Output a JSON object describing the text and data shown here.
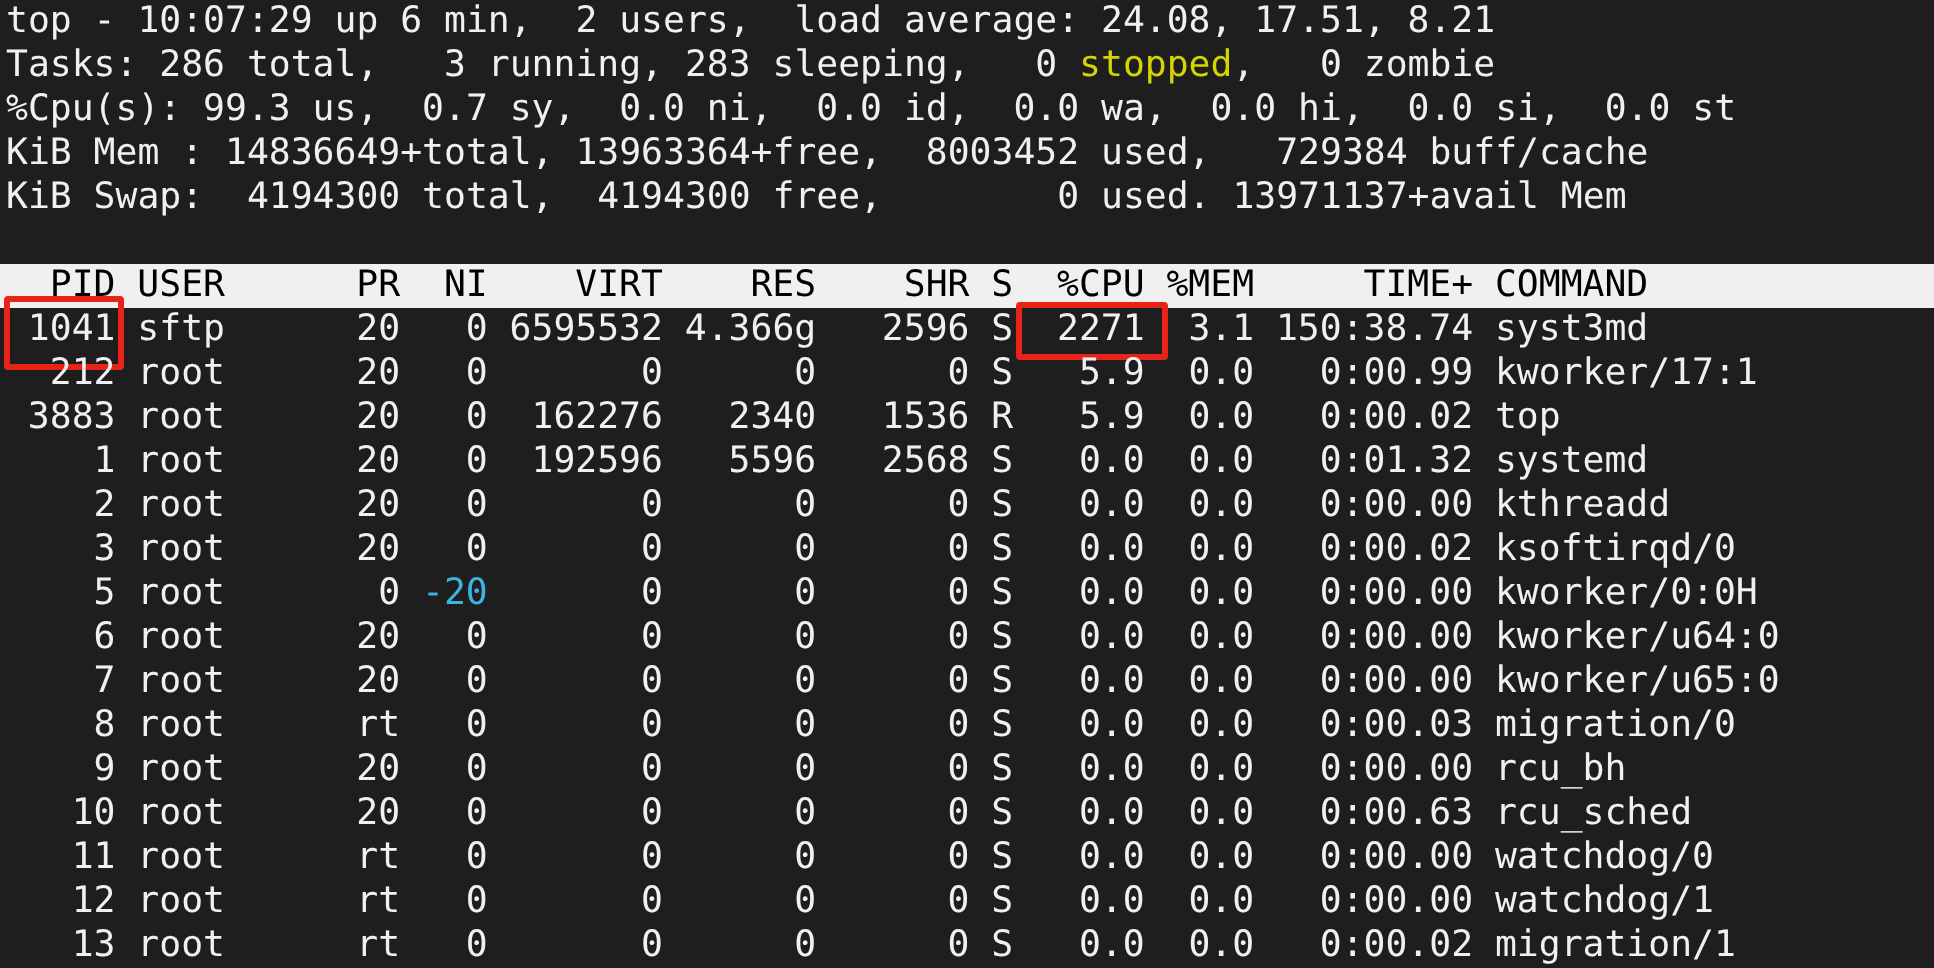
{
  "summary": [
    {
      "segments": [
        {
          "text": "top - 10:07:29 up 6 min,  2 users,  load average: 24.08, 17.51, 8.21"
        }
      ]
    },
    {
      "segments": [
        {
          "text": "Tasks: 286 total,   3 running, 283 sleeping,   0 "
        },
        {
          "text": "stopped",
          "color": "#d4d400"
        },
        {
          "text": ",   0 zombie"
        }
      ]
    },
    {
      "segments": [
        {
          "text": "%Cpu(s): 99.3 us,  0.7 sy,  0.0 ni,  0.0 id,  0.0 wa,  0.0 hi,  0.0 si,  0.0 st"
        }
      ]
    },
    {
      "segments": [
        {
          "text": "KiB Mem : 14836649+total, 13963364+free,  8003452 used,   729384 buff/cache"
        }
      ]
    },
    {
      "segments": [
        {
          "text": "KiB Swap:  4194300 total,  4194300 free,        0 used. 13971137+avail Mem"
        }
      ]
    }
  ],
  "table": {
    "columns": [
      "PID",
      "USER",
      "PR",
      "NI",
      "VIRT",
      "RES",
      "SHR",
      "S",
      "%CPU",
      "%MEM",
      "TIME+",
      "COMMAND"
    ],
    "rows": [
      {
        "cells": [
          "1041",
          "sftp",
          "20",
          "0",
          "6595532",
          "4.366g",
          "2596",
          "S",
          "2271",
          "3.1",
          "150:38.74",
          "syst3md"
        ],
        "pid_marked": true,
        "cpu_marked": true,
        "color": "#f0f0f0"
      },
      {
        "cells": [
          "212",
          "root",
          "20",
          "0",
          "0",
          "0",
          "0",
          "S",
          "5.9",
          "0.0",
          "0:00.99",
          "kworker/17:1"
        ],
        "pid_marked": false,
        "cpu_marked": false,
        "color": "#f0f0f0"
      },
      {
        "cells": [
          "3883",
          "root",
          "20",
          "0",
          "162276",
          "2340",
          "1536",
          "R",
          "5.9",
          "0.0",
          "0:00.02",
          "top"
        ],
        "pid_marked": false,
        "cpu_marked": false,
        "color": "#f0f0f0"
      },
      {
        "cells": [
          "1",
          "root",
          "20",
          "0",
          "192596",
          "5596",
          "2568",
          "S",
          "0.0",
          "0.0",
          "0:01.32",
          "systemd"
        ],
        "pid_marked": false,
        "cpu_marked": false,
        "color": "#f0f0f0"
      },
      {
        "cells": [
          "2",
          "root",
          "20",
          "0",
          "0",
          "0",
          "0",
          "S",
          "0.0",
          "0.0",
          "0:00.00",
          "kthreadd"
        ],
        "pid_marked": false,
        "cpu_marked": false,
        "color": "#f0f0f0"
      },
      {
        "cells": [
          "3",
          "root",
          "20",
          "0",
          "0",
          "0",
          "0",
          "S",
          "0.0",
          "0.0",
          "0:00.02",
          "ksoftirqd/0"
        ],
        "pid_marked": false,
        "cpu_marked": false,
        "color": "#f0f0f0"
      },
      {
        "cells": [
          "5",
          "root",
          "0",
          "-20",
          "0",
          "0",
          "0",
          "S",
          "0.0",
          "0.0",
          "0:00.00",
          "kworker/0:0H"
        ],
        "pid_marked": false,
        "cpu_marked": false,
        "color": "#3ab4e0"
      },
      {
        "cells": [
          "6",
          "root",
          "20",
          "0",
          "0",
          "0",
          "0",
          "S",
          "0.0",
          "0.0",
          "0:00.00",
          "kworker/u64:0"
        ],
        "pid_marked": false,
        "cpu_marked": false,
        "color": "#f0f0f0"
      },
      {
        "cells": [
          "7",
          "root",
          "20",
          "0",
          "0",
          "0",
          "0",
          "S",
          "0.0",
          "0.0",
          "0:00.00",
          "kworker/u65:0"
        ],
        "pid_marked": false,
        "cpu_marked": false,
        "color": "#f0f0f0"
      },
      {
        "cells": [
          "8",
          "root",
          "rt",
          "0",
          "0",
          "0",
          "0",
          "S",
          "0.0",
          "0.0",
          "0:00.03",
          "migration/0"
        ],
        "pid_marked": false,
        "cpu_marked": false,
        "color": "#f0f0f0"
      },
      {
        "cells": [
          "9",
          "root",
          "20",
          "0",
          "0",
          "0",
          "0",
          "S",
          "0.0",
          "0.0",
          "0:00.00",
          "rcu_bh"
        ],
        "pid_marked": false,
        "cpu_marked": false,
        "color": "#f0f0f0"
      },
      {
        "cells": [
          "10",
          "root",
          "20",
          "0",
          "0",
          "0",
          "0",
          "S",
          "0.0",
          "0.0",
          "0:00.63",
          "rcu_sched"
        ],
        "pid_marked": false,
        "cpu_marked": false,
        "color": "#f0f0f0"
      },
      {
        "cells": [
          "11",
          "root",
          "rt",
          "0",
          "0",
          "0",
          "0",
          "S",
          "0.0",
          "0.0",
          "0:00.00",
          "watchdog/0"
        ],
        "pid_marked": false,
        "cpu_marked": false,
        "color": "#f0f0f0"
      },
      {
        "cells": [
          "12",
          "root",
          "rt",
          "0",
          "0",
          "0",
          "0",
          "S",
          "0.0",
          "0.0",
          "0:00.00",
          "watchdog/1"
        ],
        "pid_marked": false,
        "cpu_marked": false,
        "color": "#f0f0f0"
      },
      {
        "cells": [
          "13",
          "root",
          "rt",
          "0",
          "0",
          "0",
          "0",
          "S",
          "0.0",
          "0.0",
          "0:00.02",
          "migration/1"
        ],
        "pid_marked": false,
        "cpu_marked": false,
        "color": "#f0f0f0"
      }
    ]
  }
}
